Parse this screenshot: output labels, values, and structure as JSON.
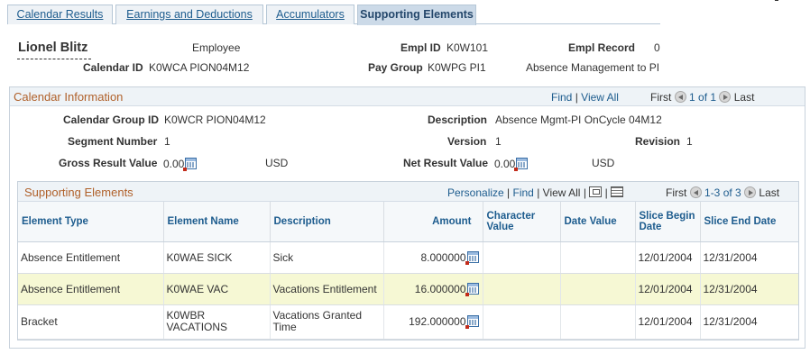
{
  "tabs": [
    {
      "label": "Calendar Results",
      "active": false
    },
    {
      "label": "Earnings and Deductions",
      "active": false
    },
    {
      "label": "Accumulators",
      "active": false
    },
    {
      "label": "Supporting Elements",
      "active": true
    }
  ],
  "header": {
    "name": "Lionel Blitz",
    "role": "Employee",
    "empl_id_label": "Empl ID",
    "empl_id": "K0W101",
    "empl_record_label": "Empl Record",
    "empl_record": "0",
    "calendar_id_label": "Calendar ID",
    "calendar_id": "K0WCA PION04M12",
    "pay_group_label": "Pay Group",
    "pay_group": "K0WPG PI1",
    "pay_group_desc": "Absence Management to PI"
  },
  "calendar_info": {
    "title": "Calendar Information",
    "find": "Find",
    "view_all": "View All",
    "first": "First",
    "range": "1 of 1",
    "last": "Last",
    "group_id_label": "Calendar Group ID",
    "group_id": "K0WCR PION04M12",
    "description_label": "Description",
    "description": "Absence Mgmt-PI OnCycle 04M12",
    "segment_label": "Segment Number",
    "segment": "1",
    "version_label": "Version",
    "version": "1",
    "revision_label": "Revision",
    "revision": "1",
    "gross_label": "Gross Result Value",
    "gross": "0.00",
    "gross_currency": "USD",
    "net_label": "Net Result Value",
    "net": "0.00",
    "net_currency": "USD"
  },
  "supporting": {
    "title": "Supporting Elements",
    "personalize": "Personalize",
    "find": "Find",
    "view_all": "View All",
    "first": "First",
    "range": "1-3 of 3",
    "last": "Last",
    "columns": [
      "Element Type",
      "Element Name",
      "Description",
      "Amount",
      "Character Value",
      "Date Value",
      "Slice Begin Date",
      "Slice End Date"
    ],
    "rows": [
      {
        "type": "Absence Entitlement",
        "name": "K0WAE SICK",
        "description": "Sick",
        "amount": "8.000000",
        "char_value": "",
        "date_value": "",
        "begin": "12/01/2004",
        "end": "12/31/2004"
      },
      {
        "type": "Absence Entitlement",
        "name": "K0WAE VAC",
        "description": "Vacations Entitlement",
        "amount": "16.000000",
        "char_value": "",
        "date_value": "",
        "begin": "12/01/2004",
        "end": "12/31/2004"
      },
      {
        "type": "Bracket",
        "name": "K0WBR VACATIONS",
        "description": "Vacations Granted Time",
        "amount": "192.000000",
        "char_value": "",
        "date_value": "",
        "begin": "12/01/2004",
        "end": "12/31/2004"
      }
    ]
  },
  "colors": {
    "accent_link": "#1d5c8e",
    "section_title": "#b0612b",
    "highlight_row": "#f6f8d4"
  }
}
